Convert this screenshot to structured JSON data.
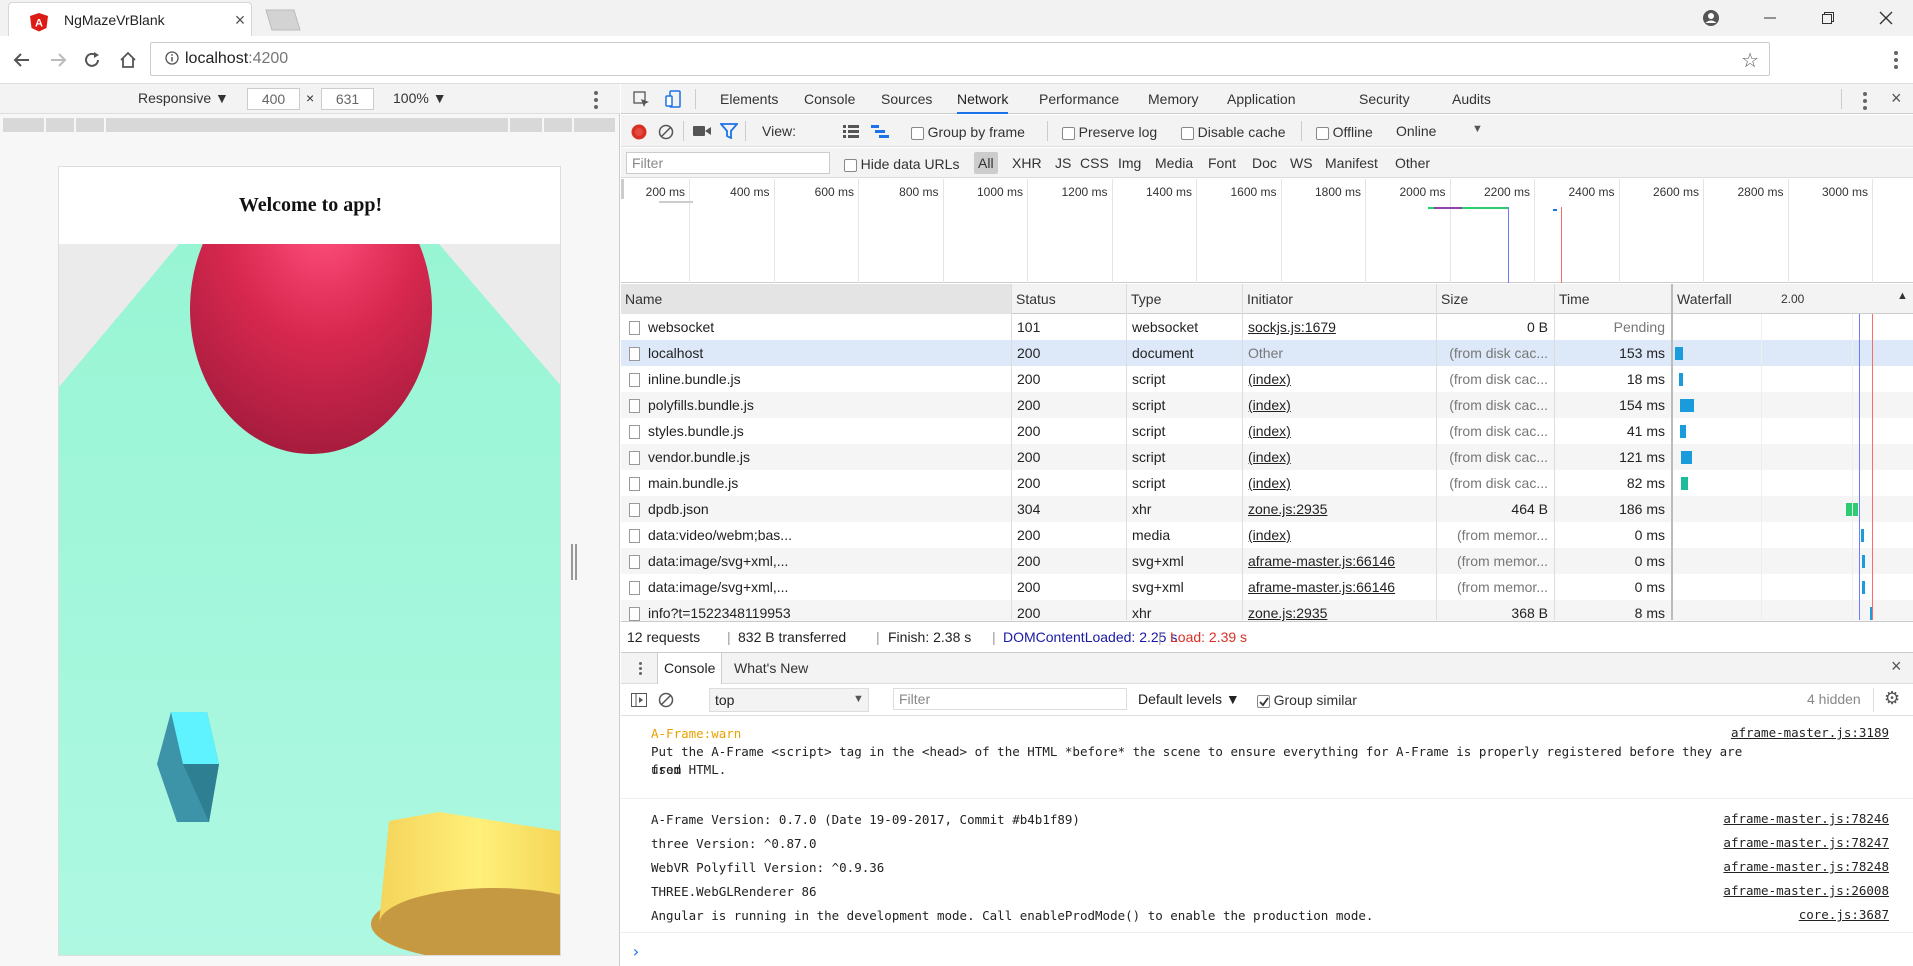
{
  "browser": {
    "tab_title": "NgMazeVrBlank",
    "address_host": "localhost",
    "address_port": ":4200"
  },
  "device_toolbar": {
    "mode": "Responsive ▼",
    "width": "400",
    "times": "×",
    "height": "631",
    "zoom": "100% ▼"
  },
  "app": {
    "heading": "Welcome to app!",
    "colors": {
      "floor": "#9ff5d6",
      "sphere": "#e0355e",
      "box": "#3fd0dc",
      "cylinder": "#f7d960"
    }
  },
  "devtools": {
    "tabs": [
      "Elements",
      "Console",
      "Sources",
      "Network",
      "Performance",
      "Memory",
      "Application",
      "Security",
      "Audits"
    ],
    "active_tab": "Network",
    "toolbar": {
      "view_label": "View:",
      "group_by_frame": "Group by frame",
      "preserve_log": "Preserve log",
      "disable_cache": "Disable cache",
      "offline": "Offline",
      "throttle": "Online"
    },
    "filter": {
      "placeholder": "Filter",
      "hide_data_urls": "Hide data URLs",
      "types": [
        "All",
        "XHR",
        "JS",
        "CSS",
        "Img",
        "Media",
        "Font",
        "Doc",
        "WS",
        "Manifest",
        "Other"
      ]
    },
    "overview_ticks": [
      "200 ms",
      "400 ms",
      "600 ms",
      "800 ms",
      "1000 ms",
      "1200 ms",
      "1400 ms",
      "1600 ms",
      "1800 ms",
      "2000 ms",
      "2200 ms",
      "2400 ms",
      "2600 ms",
      "2800 ms",
      "3000 ms"
    ],
    "columns": [
      "Name",
      "Status",
      "Type",
      "Initiator",
      "Size",
      "Time",
      "Waterfall"
    ],
    "waterfall_scale": "2.00",
    "rows": [
      {
        "name": "websocket",
        "status": "101",
        "type": "websocket",
        "initiator": "sockjs.js:1679",
        "init_link": true,
        "size": "0 B",
        "time": "Pending",
        "time_grey": true
      },
      {
        "name": "localhost",
        "status": "200",
        "type": "document",
        "initiator": "Other",
        "init_link": false,
        "size": "(from disk cac...",
        "time": "153 ms",
        "selected": true
      },
      {
        "name": "inline.bundle.js",
        "status": "200",
        "type": "script",
        "initiator": "(index)",
        "init_link": true,
        "size": "(from disk cac...",
        "time": "18 ms"
      },
      {
        "name": "polyfills.bundle.js",
        "status": "200",
        "type": "script",
        "initiator": "(index)",
        "init_link": true,
        "size": "(from disk cac...",
        "time": "154 ms"
      },
      {
        "name": "styles.bundle.js",
        "status": "200",
        "type": "script",
        "initiator": "(index)",
        "init_link": true,
        "size": "(from disk cac...",
        "time": "41 ms"
      },
      {
        "name": "vendor.bundle.js",
        "status": "200",
        "type": "script",
        "initiator": "(index)",
        "init_link": true,
        "size": "(from disk cac...",
        "time": "121 ms"
      },
      {
        "name": "main.bundle.js",
        "status": "200",
        "type": "script",
        "initiator": "(index)",
        "init_link": true,
        "size": "(from disk cac...",
        "time": "82 ms"
      },
      {
        "name": "dpdb.json",
        "status": "304",
        "type": "xhr",
        "initiator": "zone.js:2935",
        "init_link": true,
        "size": "464 B",
        "time": "186 ms"
      },
      {
        "name": "data:video/webm;bas...",
        "status": "200",
        "type": "media",
        "initiator": "(index)",
        "init_link": true,
        "size": "(from memor...",
        "time": "0 ms"
      },
      {
        "name": "data:image/svg+xml,...",
        "status": "200",
        "type": "svg+xml",
        "initiator": "aframe-master.js:66146",
        "init_link": true,
        "size": "(from memor...",
        "time": "0 ms"
      },
      {
        "name": "data:image/svg+xml,...",
        "status": "200",
        "type": "svg+xml",
        "initiator": "aframe-master.js:66146",
        "init_link": true,
        "size": "(from memor...",
        "time": "0 ms"
      },
      {
        "name": "info?t=1522348119953",
        "status": "200",
        "type": "xhr",
        "initiator": "zone.js:2935",
        "init_link": true,
        "size": "368 B",
        "time": "8 ms"
      }
    ],
    "summary": {
      "requests": "12 requests",
      "transferred": "832 B transferred",
      "finish": "Finish: 2.38 s",
      "domcontentloaded": "DOMContentLoaded: 2.25 s",
      "load": "Load: 2.39 s"
    },
    "drawer": {
      "tabs": [
        "Console",
        "What's New"
      ],
      "context": "top",
      "filter_placeholder": "Filter",
      "levels": "Default levels ▼",
      "group_similar": "Group similar",
      "hidden": "4 hidden"
    },
    "console": {
      "warn_label": "A-Frame:warn",
      "warn_source": "aframe-master.js:3189",
      "warn_line1": "Put the A-Frame <script> tag in the <head> of the HTML *before* the scene to ensure everything for A-Frame is properly registered before they are used",
      "warn_line2": "from HTML.",
      "messages": [
        {
          "text": "A-Frame Version: 0.7.0 (Date 19-09-2017, Commit #b4b1f89)",
          "source": "aframe-master.js:78246"
        },
        {
          "text": "three Version: ^0.87.0",
          "source": "aframe-master.js:78247"
        },
        {
          "text": "WebVR Polyfill Version: ^0.9.36",
          "source": "aframe-master.js:78248"
        },
        {
          "text": "THREE.WebGLRenderer 86",
          "source": "aframe-master.js:26008"
        },
        {
          "text": "Angular is running in the development mode. Call enableProdMode() to enable the production mode.",
          "source": "core.js:3687"
        }
      ],
      "prompt": "›"
    }
  }
}
